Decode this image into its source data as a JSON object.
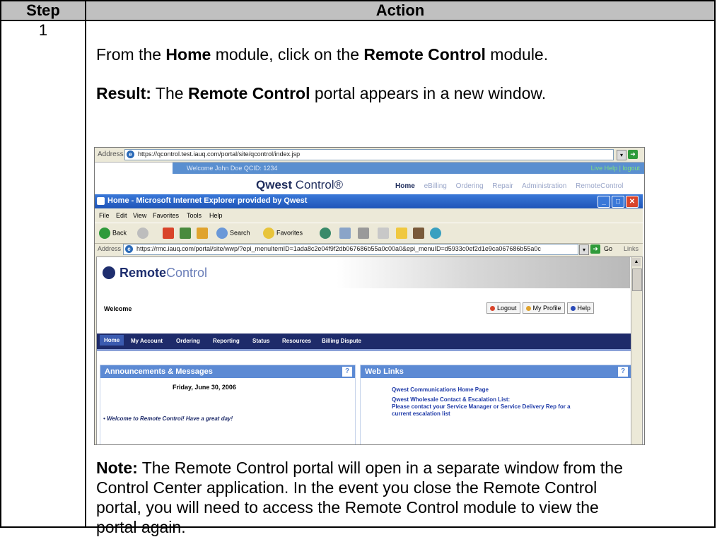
{
  "table": {
    "headers": {
      "step": "Step",
      "action": "Action"
    },
    "step_number": "1",
    "instruction": {
      "pre": "From the ",
      "b1": "Home",
      "mid": " module, click on the ",
      "b2": "Remote Control",
      "post": " module."
    },
    "result": {
      "label": "Result:",
      "pre": "  The ",
      "b1": "Remote Control",
      "post": " portal appears in a new window."
    },
    "note": {
      "label": "Note:",
      "text": "  The Remote Control portal will open in a separate window from the Control Center application.  In the event you close the Remote Control portal, you will need to access the Remote Control module to view the portal again."
    }
  },
  "screenshot": {
    "outer_address": {
      "label": "Address",
      "url": "https://qcontrol.test.iauq.com/portal/site/qcontrol/index.jsp"
    },
    "qwest": {
      "welcome": "Welcome John Doe QCID: 1234",
      "live_help": "Live Help | logout",
      "logo_bold": "Qwest",
      "logo_rest": " Control®",
      "nav": [
        "Home",
        "eBilling",
        "Ordering",
        "Repair",
        "Administration",
        "RemoteControl"
      ]
    },
    "window_title": "Home - Microsoft Internet Explorer provided by Qwest",
    "menu": [
      "File",
      "Edit",
      "View",
      "Favorites",
      "Tools",
      "Help"
    ],
    "toolbar": {
      "back": "Back",
      "search": "Search",
      "favorites": "Favorites"
    },
    "inner_address": {
      "label": "Address",
      "url": "https://rmc.iauq.com/portal/site/wwp/?epi_menuItemID=1ada8c2e04f9f2db067686b55a0c00a0&epi_menuID=d5933c0ef2d1e9ca067686b55a0c",
      "go": "Go",
      "links": "Links"
    },
    "remote_control": {
      "logo_a": "Remote",
      "logo_b": "Control",
      "welcome": "Welcome",
      "buttons": [
        "Logout",
        "My Profile",
        "Help"
      ],
      "nav": [
        "Home",
        "My Account",
        "Ordering",
        "Reporting",
        "Status",
        "Resources",
        "Billing Dispute"
      ],
      "announcements": {
        "title": "Announcements & Messages",
        "date": "Friday, June 30, 2006",
        "message": "• Welcome to Remote Control! Have a great day!"
      },
      "web_links": {
        "title": "Web Links",
        "links": [
          "Qwest Communications Home Page",
          "Qwest Wholesale Contact & Escalation List:",
          "Please contact your Service Manager or Service Delivery Rep for a",
          "current escalation list"
        ]
      }
    }
  }
}
